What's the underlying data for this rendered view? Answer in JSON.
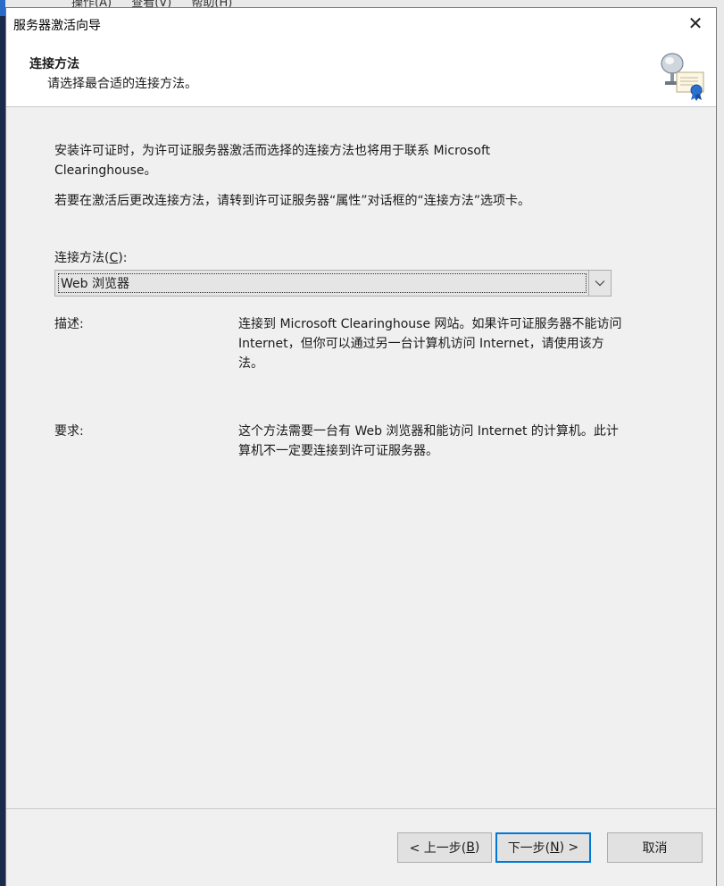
{
  "background": {
    "menu_items": [
      "操作(A)",
      "查看(V)",
      "帮助(H)"
    ]
  },
  "window": {
    "title": "服务器激活向导",
    "close_glyph": "✕"
  },
  "header": {
    "title": "连接方法",
    "subtitle": "请选择最合适的连接方法。",
    "icon": "certificate-server-icon"
  },
  "body": {
    "intro": "安装许可证时，为许可证服务器激活而选择的连接方法也将用于联系 Microsoft Clearinghouse。",
    "change_note": "若要在激活后更改连接方法，请转到许可证服务器“属性”对话框的“连接方法”选项卡。",
    "method_label_prefix": "连接方法(",
    "method_label_key": "C",
    "method_label_suffix": "):",
    "method_selected": "Web 浏览器",
    "description_label": "描述:",
    "description_text": "连接到 Microsoft Clearinghouse 网站。如果许可证服务器不能访问 Internet，但你可以通过另一台计算机访问 Internet，请使用该方法。",
    "requirements_label": "要求:",
    "requirements_text": "这个方法需要一台有 Web 浏览器和能访问 Internet 的计算机。此计算机不一定要连接到许可证服务器。"
  },
  "footer": {
    "back_prefix": "< 上一步(",
    "back_key": "B",
    "back_suffix": ")",
    "next_prefix": "下一步(",
    "next_key": "N",
    "next_suffix": ") >",
    "cancel": "取消"
  },
  "colors": {
    "focus_border": "#0078d7",
    "dialog_bg": "#f0f0f0",
    "header_bg": "#ffffff"
  }
}
